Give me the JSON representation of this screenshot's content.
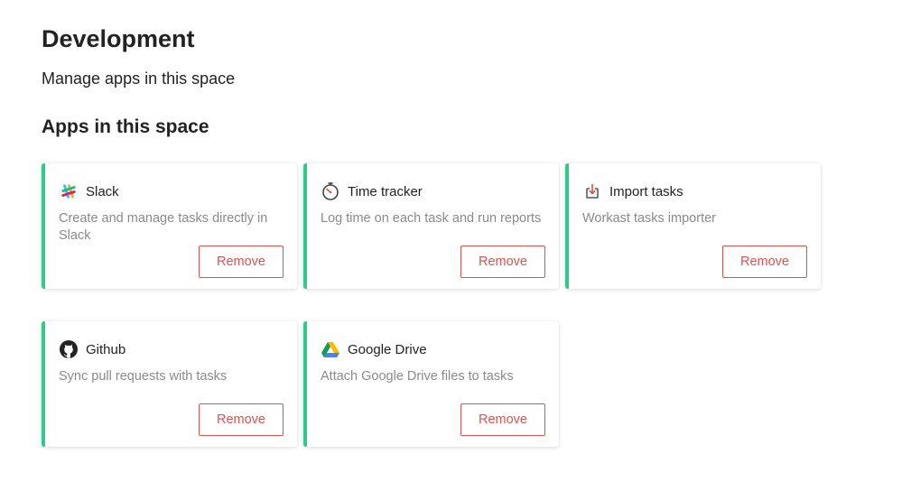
{
  "page": {
    "title": "Development",
    "subtitle": "Manage apps in this space",
    "section_title": "Apps in this space"
  },
  "colors": {
    "accent": "#2ecc8a",
    "remove": "#d9534f",
    "muted_text": "#8a8a8a"
  },
  "apps": [
    {
      "name": "Slack",
      "icon": "slack-icon",
      "description": "Create and manage tasks directly in Slack",
      "remove_label": "Remove"
    },
    {
      "name": "Time tracker",
      "icon": "stopwatch-icon",
      "description": "Log time on each task and run reports",
      "remove_label": "Remove"
    },
    {
      "name": "Import tasks",
      "icon": "import-icon",
      "description": "Workast tasks importer",
      "remove_label": "Remove"
    },
    {
      "name": "Github",
      "icon": "github-icon",
      "description": "Sync pull requests with tasks",
      "remove_label": "Remove"
    },
    {
      "name": "Google Drive",
      "icon": "google-drive-icon",
      "description": "Attach Google Drive files to tasks",
      "remove_label": "Remove"
    }
  ]
}
